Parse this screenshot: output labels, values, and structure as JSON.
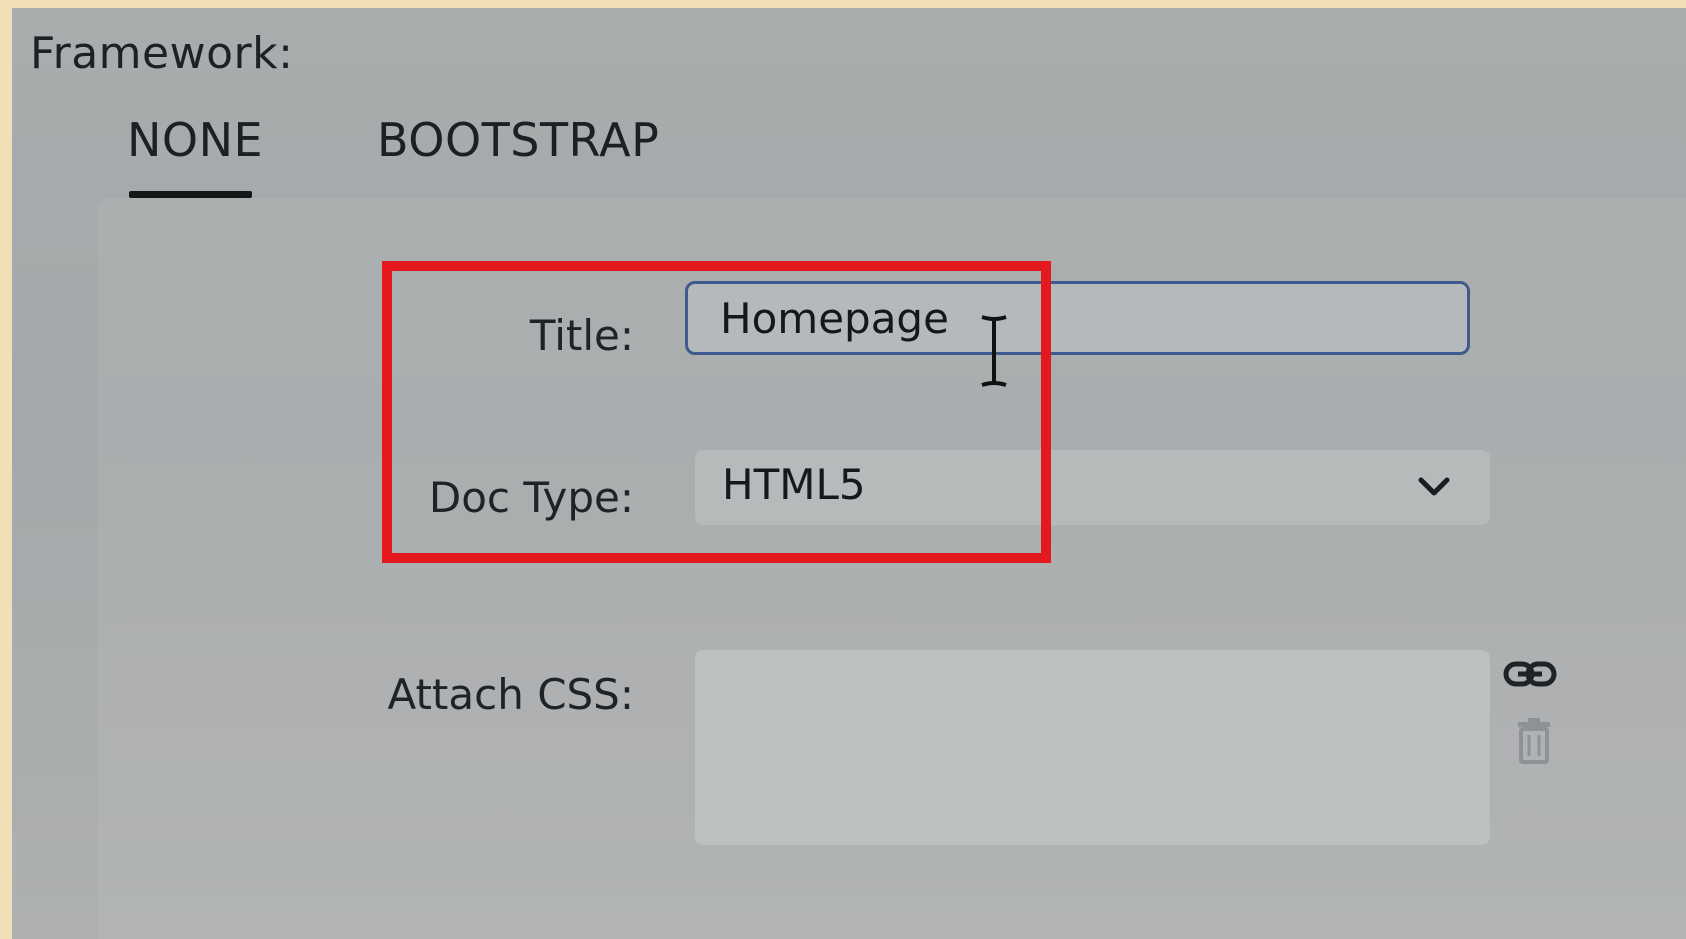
{
  "framework": {
    "label": "Framework:",
    "tabs": [
      {
        "label": "NONE",
        "selected": true
      },
      {
        "label": "BOOTSTRAP",
        "selected": false
      }
    ]
  },
  "form": {
    "title": {
      "label": "Title:",
      "value": "Homepage"
    },
    "doc_type": {
      "label": "Doc Type:",
      "value": "HTML5"
    },
    "attach_css": {
      "label": "Attach CSS:"
    }
  },
  "icons": {
    "chevron": "chevron-down-icon",
    "link": "link-icon",
    "trash": "trash-icon",
    "cursor": "text-cursor-icon"
  },
  "colors": {
    "highlight": "#e3191e",
    "input_border": "#3e5a8f",
    "background": "#a9acad"
  }
}
